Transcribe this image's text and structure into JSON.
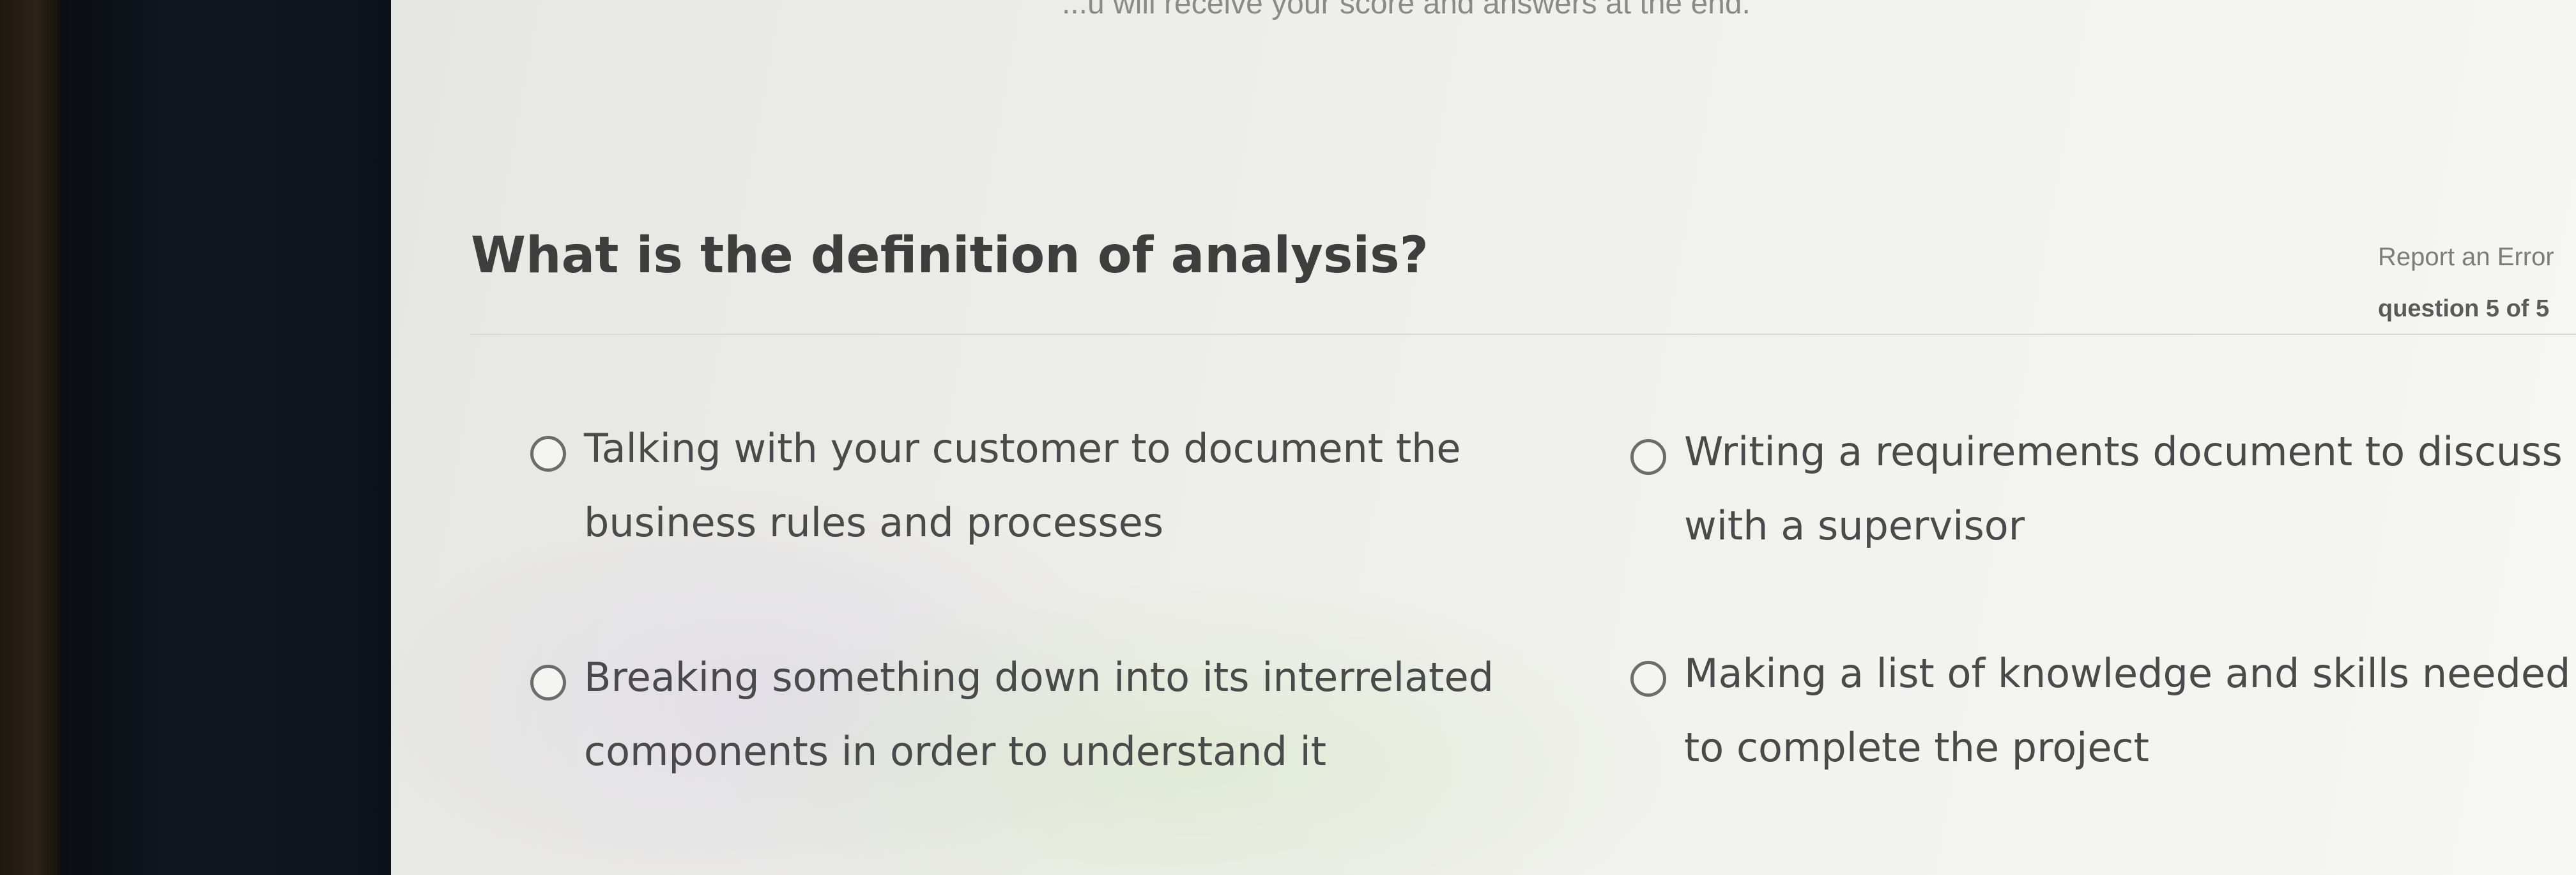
{
  "intro_text": "...u will receive your score and answers at the end.",
  "question": {
    "title": "What is the definition of analysis?",
    "report_error_label": "Report an Error",
    "counter": "question 5 of 5"
  },
  "options": [
    {
      "label": "Talking with your customer to document the business rules and processes",
      "selected": false
    },
    {
      "label": "Writing a requirements document to discuss with a supervisor",
      "selected": false
    },
    {
      "label": "Breaking something down into its interrelated components in order to understand it",
      "selected": false
    },
    {
      "label": "Making a list of knowledge and skills needed to complete the project",
      "selected": false
    }
  ],
  "colors": {
    "page_background": "#eeeeeb",
    "title_text": "#3e3e3e",
    "option_text": "#4a4a4a",
    "radio_border": "#6c6c6c",
    "muted_text": "#7c7c7c",
    "bezel": "#0d121a"
  },
  "icons": {
    "radio_unselected": "radio-unselected-icon"
  }
}
